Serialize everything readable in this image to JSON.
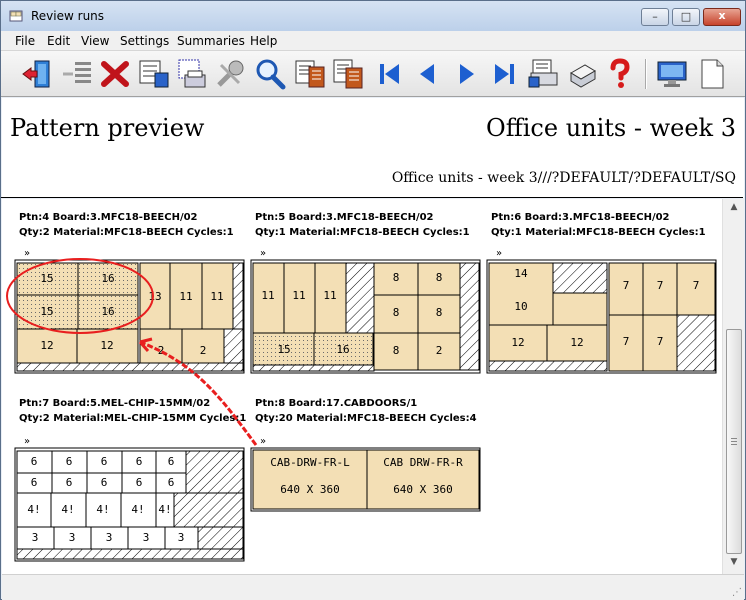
{
  "window": {
    "title": "Review runs",
    "min_label": "–",
    "max_label": "□",
    "close_label": "x"
  },
  "menu": [
    "File",
    "Edit",
    "View",
    "Settings",
    "Summaries",
    "Help"
  ],
  "toolbar_icons": [
    "exit-icon",
    "delete-run-icon",
    "cancel-icon",
    "pattern-list-icon",
    "pattern-print-icon",
    "tools-icon",
    "search-icon",
    "report-icon",
    "report-list-icon",
    "first-page-icon",
    "previous-page-icon",
    "next-page-icon",
    "last-page-icon",
    "batch-print-icon",
    "printer-icon",
    "help-icon",
    "display-settings-icon",
    "document-icon"
  ],
  "header": {
    "left_title": "Pattern preview",
    "right_title": "Office units - week 3",
    "subtitle": "Office units - week 3///?DEFAULT/?DEFAULT/SQ"
  },
  "patterns": [
    {
      "ptn": "Ptn:4",
      "board": "Board:3.MFC18-BEECH/02",
      "qty": "Qty:2",
      "material": "Material:MFC18-BEECH",
      "cycles": "Cycles:1",
      "labels": [
        "15",
        "16",
        "15",
        "16",
        "13",
        "11",
        "11",
        "12",
        "12",
        "2",
        "2"
      ]
    },
    {
      "ptn": "Ptn:5",
      "board": "Board:3.MFC18-BEECH/02",
      "qty": "Qty:1",
      "material": "Material:MFC18-BEECH",
      "cycles": "Cycles:1",
      "labels": [
        "11",
        "11",
        "11",
        "8",
        "8",
        "8",
        "8",
        "15",
        "16",
        "8",
        "2"
      ]
    },
    {
      "ptn": "Ptn:6",
      "board": "Board:3.MFC18-BEECH/02",
      "qty": "Qty:1",
      "material": "Material:MFC18-BEECH",
      "cycles": "Cycles:1",
      "labels": [
        "14",
        "10",
        "12",
        "12",
        "7",
        "7",
        "7",
        "7",
        "7"
      ]
    },
    {
      "ptn": "Ptn:7",
      "board": "Board:5.MEL-CHIP-15MM/02",
      "qty": "Qty:2",
      "material": "Material:MEL-CHIP-15MM",
      "cycles": "Cycles:1",
      "labels": [
        "6",
        "6",
        "6",
        "6",
        "6",
        "6",
        "6",
        "6",
        "6",
        "6",
        "4!",
        "4!",
        "4!",
        "4!",
        "4!",
        "3",
        "3",
        "3",
        "3",
        "3"
      ]
    },
    {
      "ptn": "Ptn:8",
      "board": "Board:17.CABDOORS/1",
      "qty": "Qty:20",
      "material": "Material:MFC18-BEECH",
      "cycles": "Cycles:4",
      "labels": [
        "CAB-DRW-FR-L",
        "CAB DRW-FR-R",
        "640 X 360",
        "640 X 360"
      ]
    }
  ]
}
